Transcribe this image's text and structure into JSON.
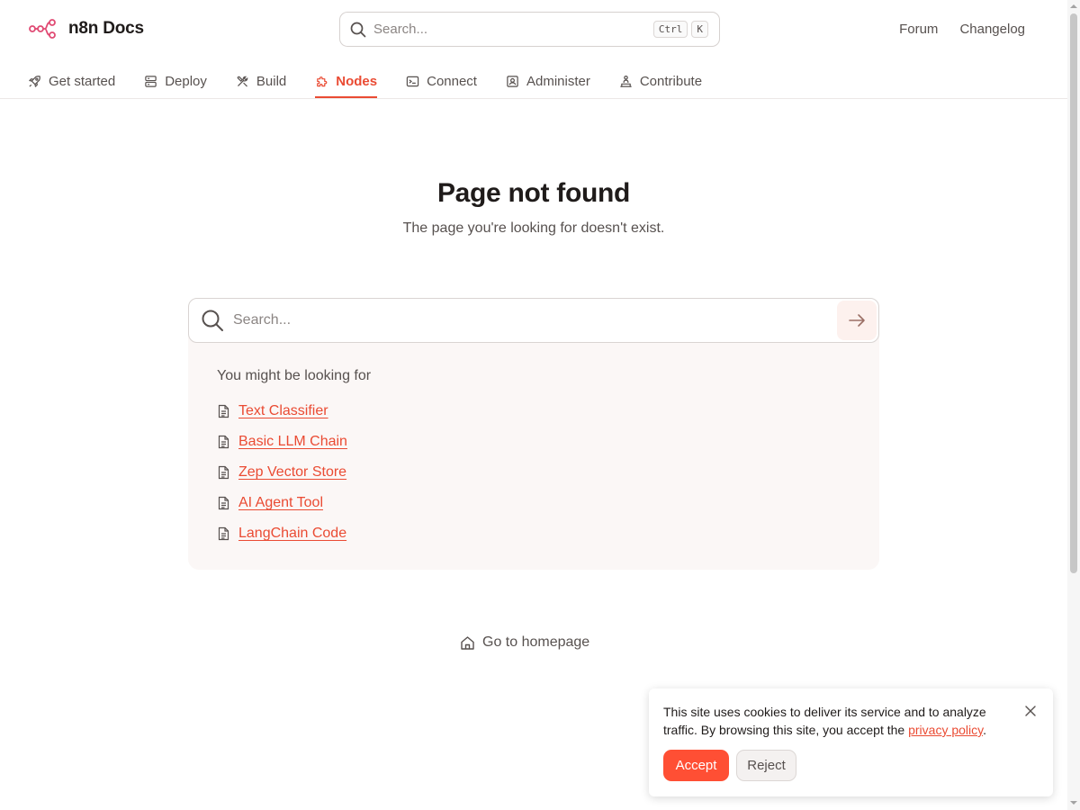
{
  "header": {
    "brand": "n8n Docs",
    "search": {
      "placeholder": "Search...",
      "shortcut_keys": [
        "Ctrl",
        "K"
      ]
    },
    "links": [
      "Forum",
      "Changelog"
    ]
  },
  "tabs": [
    {
      "label": "Get started",
      "icon": "rocket-icon"
    },
    {
      "label": "Deploy",
      "icon": "server-icon"
    },
    {
      "label": "Build",
      "icon": "tools-icon"
    },
    {
      "label": "Nodes",
      "icon": "puzzle-icon",
      "active": true
    },
    {
      "label": "Connect",
      "icon": "terminal-icon"
    },
    {
      "label": "Administer",
      "icon": "admin-icon"
    },
    {
      "label": "Contribute",
      "icon": "contribute-icon"
    }
  ],
  "main": {
    "title": "Page not found",
    "subtitle": "The page you're looking for doesn't exist.",
    "search_placeholder": "Search...",
    "suggestions_title": "You might be looking for",
    "suggestions": [
      "Text Classifier",
      "Basic LLM Chain",
      "Zep Vector Store",
      "AI Agent Tool",
      "LangChain Code"
    ],
    "home_link": "Go to homepage"
  },
  "cookie": {
    "text_before": "This site uses cookies to deliver its service and to analyze traffic. By browsing this site, you accept the ",
    "link": "privacy policy",
    "text_after": ".",
    "accept": "Accept",
    "reject": "Reject"
  },
  "colors": {
    "accent": "#ea4b33",
    "accept_bg": "#ff4f34",
    "logo": "#e04a73"
  }
}
